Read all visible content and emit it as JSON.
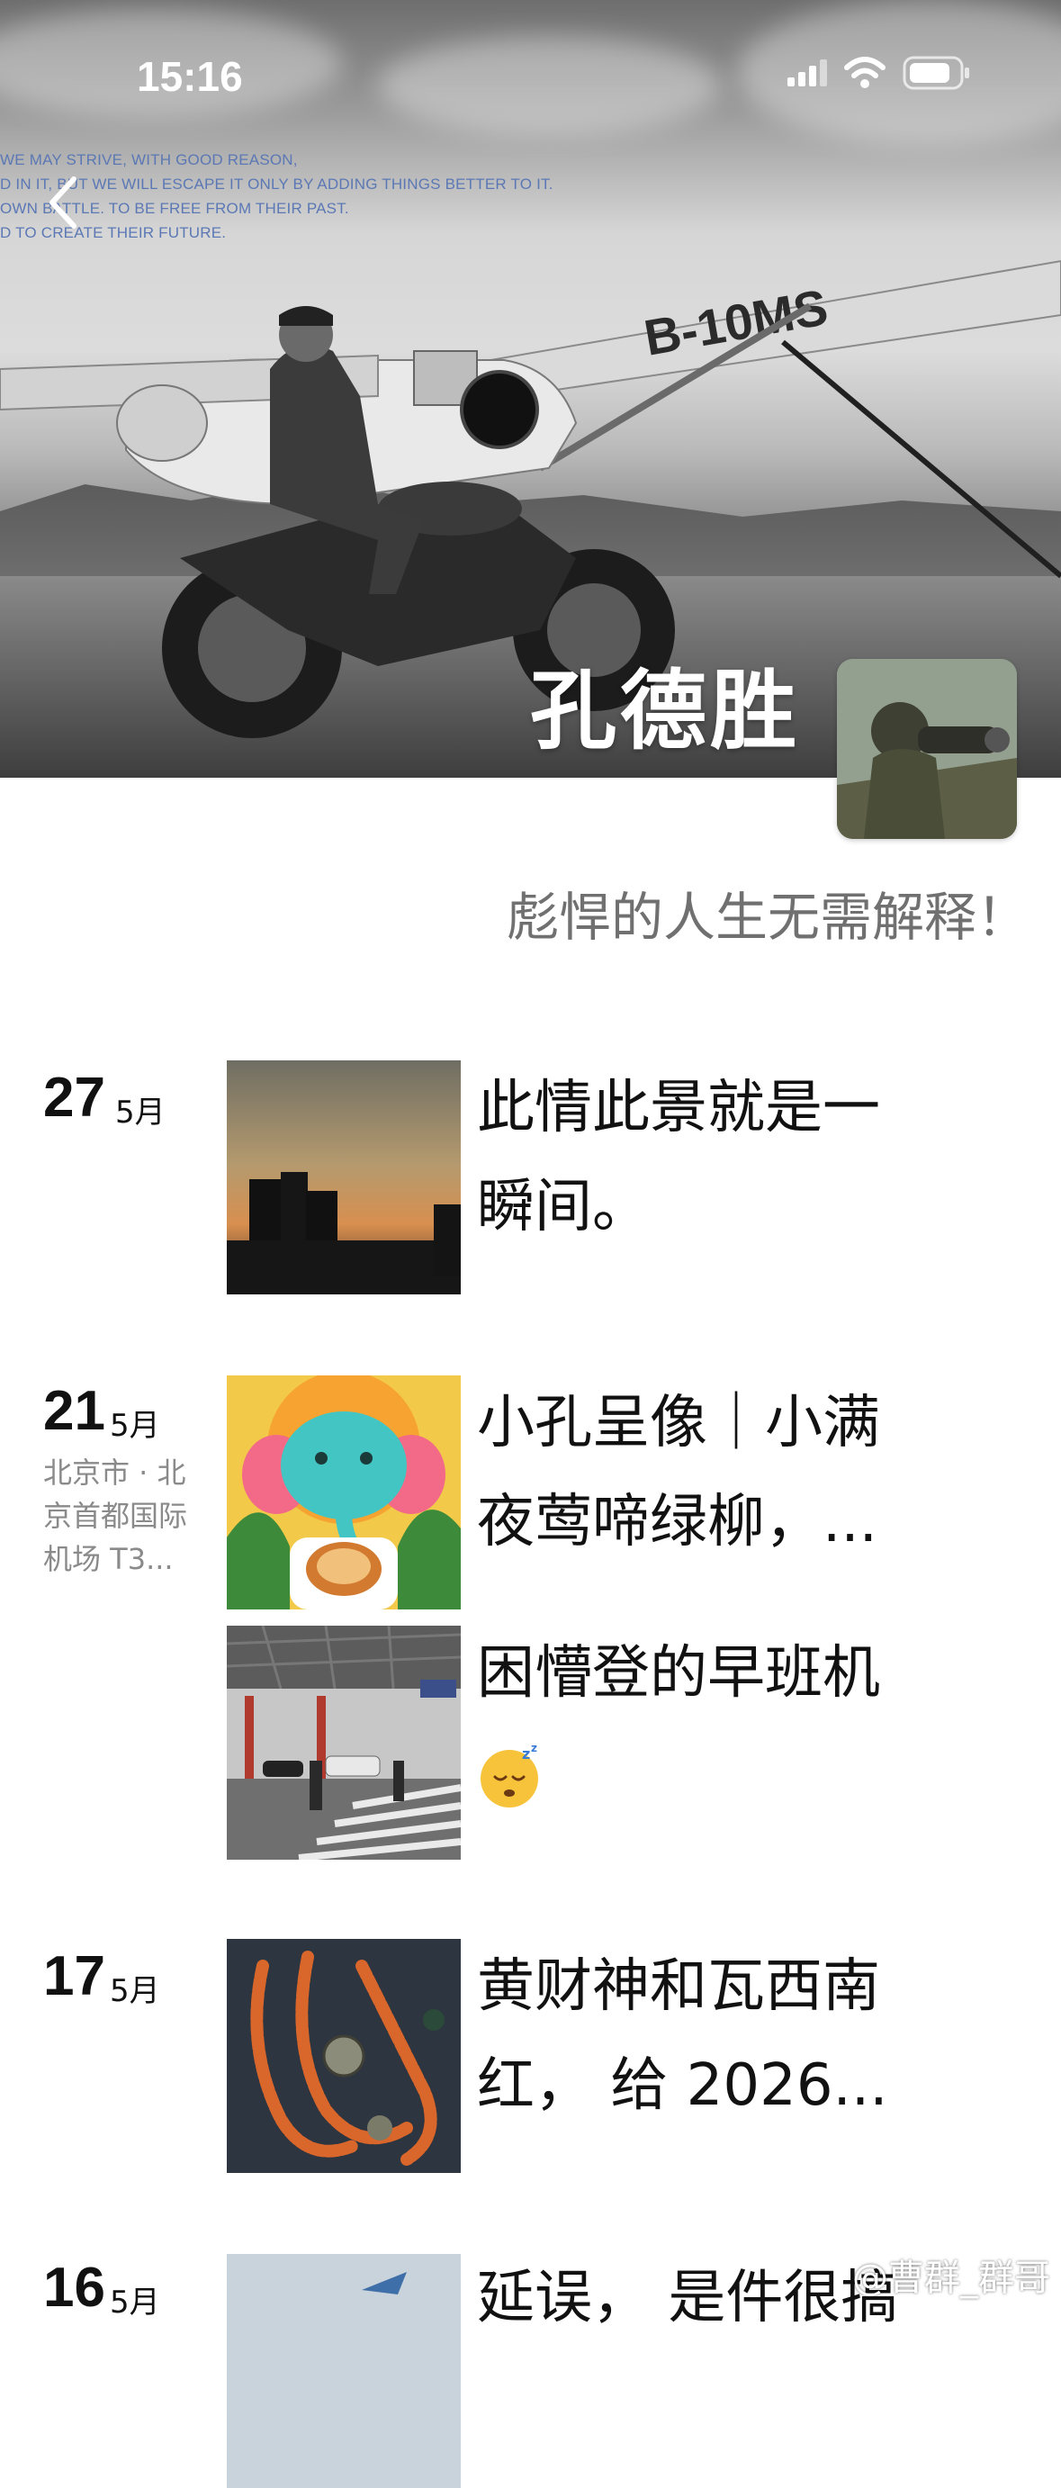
{
  "status_bar": {
    "time": "15:16"
  },
  "cover": {
    "motto_lines": [
      "WE MAY STRIVE, WITH GOOD REASON,",
      "D IN IT, BUT WE WILL ESCAPE IT ONLY BY ADDING THINGS BETTER TO IT.",
      "OWN BATTLE. TO BE FREE FROM THEIR PAST.",
      "D TO CREATE THEIR FUTURE."
    ],
    "plane_registration": "B-10MS"
  },
  "profile": {
    "name": "孔德胜",
    "signature": "彪悍的人生无需解释！"
  },
  "posts": [
    {
      "day": "27",
      "month": "5月",
      "location": "",
      "text_lines": [
        "此情此景就是一",
        "瞬间。"
      ],
      "thumb": "sunset-city"
    },
    {
      "day": "21",
      "month": "5月",
      "location": "北京市 · 北京首都国际机场 T3...",
      "text_lines": [
        "小孔呈像｜小满",
        "夜莺啼绿柳，..."
      ],
      "thumb": "elephant-illustration"
    },
    {
      "day": "",
      "month": "",
      "location": "",
      "text_lines": [
        "困懵登的早班机",
        ""
      ],
      "emoji": "sleeping-face",
      "thumb": "airport-terminal"
    },
    {
      "day": "17",
      "month": "5月",
      "location": "",
      "text_lines": [
        "黄财神和瓦西南",
        "红， 给 2026..."
      ],
      "thumb": "prayer-beads"
    },
    {
      "day": "16",
      "month": "5月",
      "location": "",
      "text_lines": [
        "延误， 是件很搞"
      ],
      "thumb": "airplane-sky"
    }
  ],
  "watermark": "@曹群_群哥"
}
